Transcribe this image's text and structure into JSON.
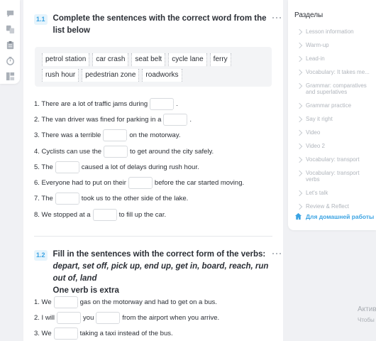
{
  "left_rail": {
    "icons": [
      "message-icon",
      "translate-icon",
      "clipboard-icon",
      "timer-icon",
      "layout-icon"
    ]
  },
  "task1": {
    "number": "1.1",
    "title": "Complete the sentences with the correct word from the list below",
    "words": [
      "petrol station",
      "car crash",
      "seat belt",
      "cycle lane",
      "ferry",
      "rush hour",
      "pedestrian zone",
      "roadworks"
    ],
    "sentences": [
      {
        "before": "1. There are a lot of traffic jams during",
        "after": "."
      },
      {
        "before": "2. The van driver was fined for parking in a",
        "after": "."
      },
      {
        "before": "3. There was a terrible",
        "after": "on the motorway."
      },
      {
        "before": "4. Cyclists can use the",
        "after": "to get around the city safely."
      },
      {
        "before": "5. The",
        "after": "caused a lot of delays during rush hour."
      },
      {
        "before": "6. Everyone had to put on their",
        "after": "before the car started moving."
      },
      {
        "before": "7. The",
        "after": "took us to the other side of the lake."
      },
      {
        "before": "8. We stopped at a",
        "after": "to fill up the car."
      }
    ]
  },
  "task2": {
    "number": "1.2",
    "title": "Fill in the sentences with the correct form of the verbs:",
    "verbs": "depart, set off, pick up, end up, get in, board, reach, run out of, land",
    "note": "One verb is extra",
    "sentences": [
      {
        "before": "1. We",
        "after": "gas on the motorway and had to get on a bus."
      },
      {
        "before": "2. I will",
        "middle": "you",
        "after": "from the airport when you arrive."
      },
      {
        "before": "3. We",
        "after": "taking a taxi instead of the bus."
      }
    ]
  },
  "sidebar": {
    "title": "Разделы",
    "items": [
      "Lesson information",
      "Warm-up",
      "Lead-in",
      "Vocabulary: It takes me...",
      "Grammar: comparatives and superlatives",
      "Grammar practice",
      "Say it right",
      "Video",
      "Video 2",
      "Vocabulary: transport",
      "Vocabulary: transport verbs",
      "Let's talk",
      "Review & Reflect"
    ],
    "home_link": "Для домашней работы"
  },
  "watermark": {
    "line1": "Актив",
    "line2": "Чтобы"
  },
  "colors": {
    "accent": "#3aa3e3",
    "muted": "#b0b5bc"
  }
}
